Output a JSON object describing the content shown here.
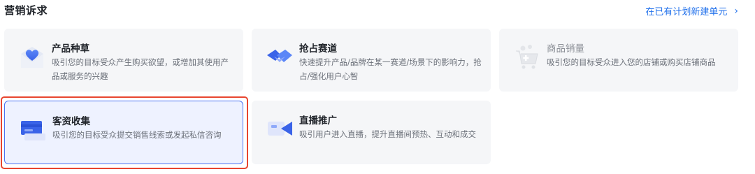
{
  "header": {
    "title": "营销诉求",
    "link_label": "在已有计划新建单元",
    "link_chevron": "›"
  },
  "cards": [
    {
      "title": "产品种草",
      "desc": "吸引您的目标受众产生购买欲望，或增加其使用产品或服务的兴趣",
      "icon": "heart-envelope-icon",
      "state": "normal"
    },
    {
      "title": "抢占赛道",
      "desc": "快速提升产品/品牌在某一赛道/场景下的影响力，抢占/强化用户心智",
      "icon": "handshake-icon",
      "state": "normal"
    },
    {
      "title": "商品销量",
      "desc": "吸引您的目标受众进入您的店铺或购买店铺商品",
      "icon": "shopping-cart-icon",
      "state": "disabled"
    },
    {
      "title": "客资收集",
      "desc": "吸引您的目标受众提交销售线索或发起私信咨询",
      "icon": "id-card-icon",
      "state": "selected"
    },
    {
      "title": "直播推广",
      "desc": "吸引用户进入直播，提升直播间预热、互动和成交",
      "icon": "video-camera-icon",
      "state": "normal"
    }
  ],
  "colors": {
    "accent": "#1f6feb",
    "selected_border": "#4a73f2",
    "highlight_outline": "#e8452f",
    "card_bg": "#f5f6f8"
  }
}
